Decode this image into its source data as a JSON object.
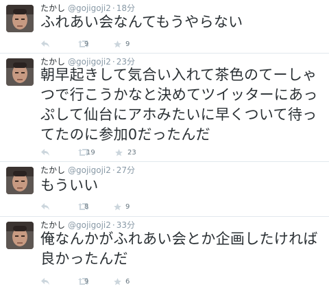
{
  "tweets": [
    {
      "name": "たかし",
      "handle": "@gojigoji2",
      "separator": "·",
      "time": "18分",
      "text": "ふれあい会なんてもうやらない",
      "retweets": "9",
      "favorites": "9"
    },
    {
      "name": "たかし",
      "handle": "@gojigoji2",
      "separator": "·",
      "time": "23分",
      "text_lines": [
        "朝早起きして気合い入れて茶色のてーしゃ",
        "つで行こうかなと決めてツイッターにあっ",
        "ぷして仙台にアホみたいに早くついて待っ",
        "てたのに参加0だったんだ"
      ],
      "retweets": "19",
      "favorites": "23"
    },
    {
      "name": "たかし",
      "handle": "@gojigoji2",
      "separator": "·",
      "time": "27分",
      "text": "もういい",
      "retweets": "8",
      "favorites": "9"
    },
    {
      "name": "たかし",
      "handle": "@gojigoji2",
      "separator": "·",
      "time": "33分",
      "text_lines": [
        "俺なんかがふれあい会とか企画したければ",
        "良かったんだ"
      ],
      "retweets": "9",
      "favorites": "6"
    }
  ],
  "icons": {
    "reply": "reply-arrow-icon",
    "retweet": "retweet-icon",
    "favorite": "star-icon"
  },
  "colors": {
    "text": "#292f33",
    "meta": "#8899a6",
    "divider": "#e1e8ed"
  }
}
